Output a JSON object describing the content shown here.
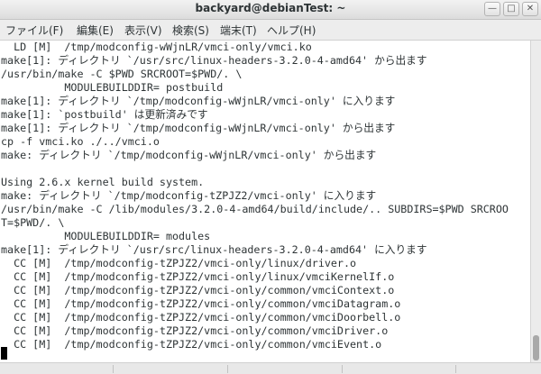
{
  "window": {
    "title": "backyard@debianTest: ~",
    "minimize_glyph": "—",
    "maximize_glyph": "□",
    "close_glyph": "✕"
  },
  "menu": {
    "items": [
      "ファイル(F)",
      "編集(E)",
      "表示(V)",
      "検索(S)",
      "端末(T)",
      "ヘルプ(H)"
    ]
  },
  "terminal": {
    "lines": [
      "  LD [M]  /tmp/modconfig-wWjnLR/vmci-only/vmci.ko",
      "make[1]: ディレクトリ `/usr/src/linux-headers-3.2.0-4-amd64' から出ます",
      "/usr/bin/make -C $PWD SRCROOT=$PWD/. \\",
      "          MODULEBUILDDIR= postbuild",
      "make[1]: ディレクトリ `/tmp/modconfig-wWjnLR/vmci-only' に入ります",
      "make[1]: `postbuild' は更新済みです",
      "make[1]: ディレクトリ `/tmp/modconfig-wWjnLR/vmci-only' から出ます",
      "cp -f vmci.ko ./../vmci.o",
      "make: ディレクトリ `/tmp/modconfig-wWjnLR/vmci-only' から出ます",
      "",
      "Using 2.6.x kernel build system.",
      "make: ディレクトリ `/tmp/modconfig-tZPJZ2/vmci-only' に入ります",
      "/usr/bin/make -C /lib/modules/3.2.0-4-amd64/build/include/.. SUBDIRS=$PWD SRCROO",
      "T=$PWD/. \\",
      "          MODULEBUILDDIR= modules",
      "make[1]: ディレクトリ `/usr/src/linux-headers-3.2.0-4-amd64' に入ります",
      "  CC [M]  /tmp/modconfig-tZPJZ2/vmci-only/linux/driver.o",
      "  CC [M]  /tmp/modconfig-tZPJZ2/vmci-only/linux/vmciKernelIf.o",
      "  CC [M]  /tmp/modconfig-tZPJZ2/vmci-only/common/vmciContext.o",
      "  CC [M]  /tmp/modconfig-tZPJZ2/vmci-only/common/vmciDatagram.o",
      "  CC [M]  /tmp/modconfig-tZPJZ2/vmci-only/common/vmciDoorbell.o",
      "  CC [M]  /tmp/modconfig-tZPJZ2/vmci-only/common/vmciDriver.o",
      "  CC [M]  /tmp/modconfig-tZPJZ2/vmci-only/common/vmciEvent.o"
    ]
  },
  "colors": {
    "terminal_bg": "#ffffff",
    "terminal_fg": "#2e3436",
    "cursor": "#000000"
  }
}
